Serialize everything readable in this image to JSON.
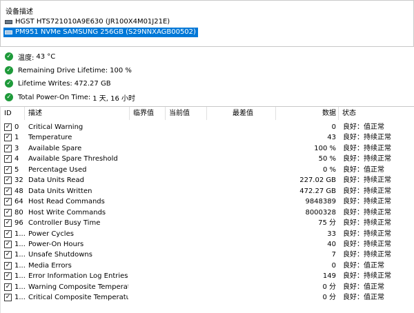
{
  "device_panel": {
    "title": "设备描述",
    "devices": [
      {
        "label": "HGST HTS721010A9E630 (JR100X4M01J21E)",
        "selected": false
      },
      {
        "label": "PM951 NVMe SAMSUNG 256GB (S29NNXAGB00502)",
        "selected": true
      }
    ]
  },
  "status": [
    {
      "label": "温度:",
      "value": "43 °C"
    },
    {
      "label": "Remaining Drive Lifetime:",
      "value": "100 %"
    },
    {
      "label": "Lifetime Writes:",
      "value": "472.27 GB"
    },
    {
      "label": "Total Power-On Time:",
      "value": "1 天, 16 小时"
    }
  ],
  "table": {
    "columns": {
      "id": "ID",
      "desc": "描述",
      "threshold": "临界值",
      "current": "当前值",
      "worst": "最差值",
      "data": "数据",
      "status": "状态"
    },
    "rows": [
      {
        "id": "0",
        "desc": "Critical Warning",
        "data": "0",
        "status": "良好：值正常"
      },
      {
        "id": "1",
        "desc": "Temperature",
        "data": "43",
        "status": "良好：持续正常"
      },
      {
        "id": "3",
        "desc": "Available Spare",
        "data": "100 %",
        "status": "良好：持续正常"
      },
      {
        "id": "4",
        "desc": "Available Spare Threshold",
        "data": "50 %",
        "status": "良好：持续正常"
      },
      {
        "id": "5",
        "desc": "Percentage Used",
        "data": "0 %",
        "status": "良好：值正常"
      },
      {
        "id": "32",
        "desc": "Data Units Read",
        "data": "227.02 GB",
        "status": "良好：持续正常"
      },
      {
        "id": "48",
        "desc": "Data Units Written",
        "data": "472.27 GB",
        "status": "良好：持续正常"
      },
      {
        "id": "64",
        "desc": "Host Read Commands",
        "data": "9848389",
        "status": "良好：持续正常"
      },
      {
        "id": "80",
        "desc": "Host Write Commands",
        "data": "8000328",
        "status": "良好：持续正常"
      },
      {
        "id": "96",
        "desc": "Controller Busy Time",
        "data": "75 分",
        "status": "良好：持续正常"
      },
      {
        "id": "1...",
        "desc": "Power Cycles",
        "data": "33",
        "status": "良好：持续正常"
      },
      {
        "id": "1...",
        "desc": "Power-On Hours",
        "data": "40",
        "status": "良好：持续正常"
      },
      {
        "id": "1...",
        "desc": "Unsafe Shutdowns",
        "data": "7",
        "status": "良好：持续正常"
      },
      {
        "id": "1...",
        "desc": "Media Errors",
        "data": "0",
        "status": "良好：值正常"
      },
      {
        "id": "1...",
        "desc": "Error Information Log Entries",
        "data": "149",
        "status": "良好：持续正常"
      },
      {
        "id": "1...",
        "desc": "Warning Composite Temperatu...",
        "data": "0 分",
        "status": "良好：值正常"
      },
      {
        "id": "1...",
        "desc": "Critical Composite Temperatur...",
        "data": "0 分",
        "status": "良好：值正常"
      }
    ]
  },
  "colors": {
    "ok_icon": "#1e9a3a",
    "selection": "#0078d7"
  }
}
